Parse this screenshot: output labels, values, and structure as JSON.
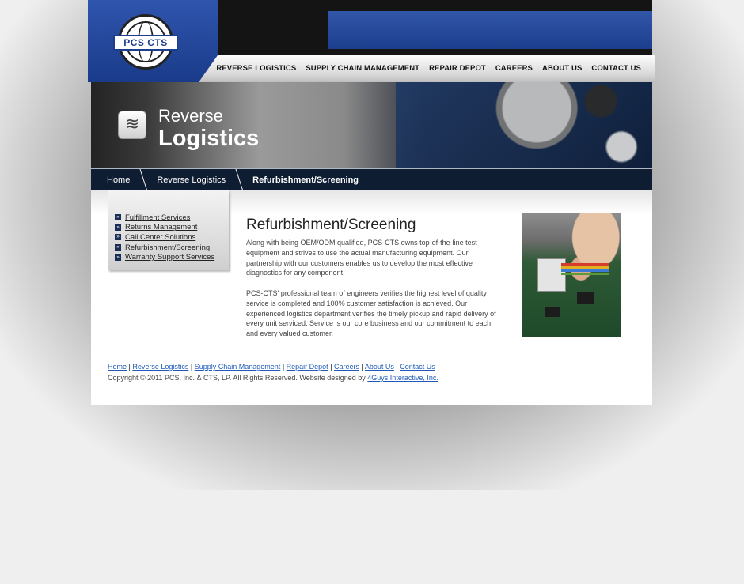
{
  "brand": {
    "logo_text": "PCS CTS"
  },
  "nav": {
    "items": [
      "REVERSE LOGISTICS",
      "SUPPLY CHAIN MANAGEMENT",
      "REPAIR DEPOT",
      "CAREERS",
      "ABOUT US",
      "CONTACT US"
    ]
  },
  "hero": {
    "title_line1": "Reverse",
    "title_line2": "Logistics",
    "icon": "waves-icon"
  },
  "breadcrumb": {
    "home": "Home",
    "section": "Reverse Logistics",
    "current": "Refurbishment/Screening"
  },
  "sidebar": {
    "items": [
      "Fulfillment Services",
      "Returns Management",
      "Call Center Solutions",
      "Refurbishment/Screening",
      "Warranty Support Services"
    ]
  },
  "main": {
    "title": "Refurbishment/Screening",
    "paragraph1": "Along with being OEM/ODM qualified, PCS-CTS owns top-of-the-line test equipment and strives to use the actual manufacturing equipment. Our partnership with our customers enables us to develop the most effective diagnostics for any component.",
    "paragraph2": "PCS-CTS' professional team of engineers verifies the highest level of quality service is completed and 100% customer satisfaction is achieved. Our experienced logistics department verifies the timely pickup and rapid delivery of every unit serviced. Service is our core business and our commitment to each and every valued customer."
  },
  "footer": {
    "links": [
      "Home",
      "Reverse Logistics",
      "Supply Chain Management",
      "Repair Depot",
      "Careers",
      "About Us",
      "Contact Us"
    ],
    "copyright_text": "Copyright © 2011 PCS, Inc. & CTS, LP. All Rights Reserved. Website designed by ",
    "designer_link": "4Guys Interactive, Inc."
  }
}
